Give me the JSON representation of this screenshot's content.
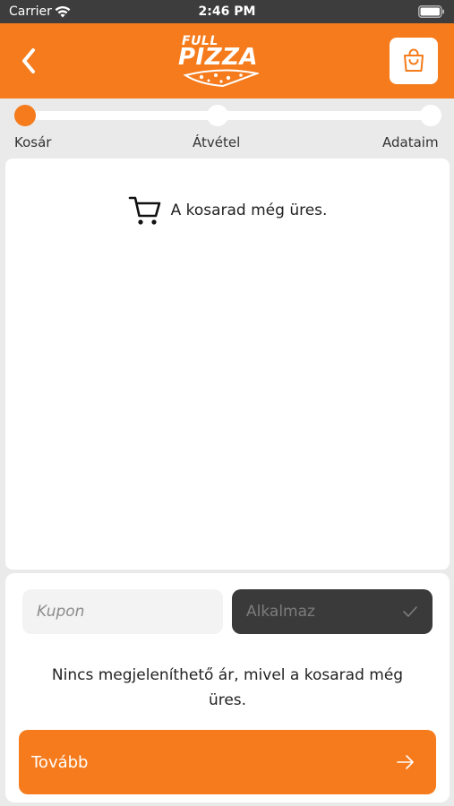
{
  "status_bar": {
    "carrier": "Carrier",
    "time": "2:46 PM",
    "wifi_icon": "wifi-icon",
    "battery_icon": "battery-icon"
  },
  "header": {
    "back_icon": "chevron-left-icon",
    "logo_top": "FULL",
    "logo_main": "PIZZA",
    "cart_icon": "shopping-bag-icon",
    "background": "#f57b1c"
  },
  "progress": {
    "current_step": 1,
    "steps": [
      {
        "label": "Kosár"
      },
      {
        "label": "Átvétel"
      },
      {
        "label": "Adataim"
      }
    ]
  },
  "cart": {
    "empty_icon": "shopping-cart-icon",
    "empty_message": "A kosarad még üres."
  },
  "coupon": {
    "placeholder": "Kupon",
    "value": "",
    "apply_label": "Alkalmaz",
    "apply_icon": "check-icon"
  },
  "summary": {
    "price_note": "Nincs megjeleníthető ár, mivel a kosarad még üres."
  },
  "footer": {
    "next_label": "Tovább",
    "next_icon": "arrow-right-icon"
  },
  "colors": {
    "accent": "#f57b1c",
    "apply_background": "#3a3a3a",
    "page_background": "#eaeaea"
  }
}
